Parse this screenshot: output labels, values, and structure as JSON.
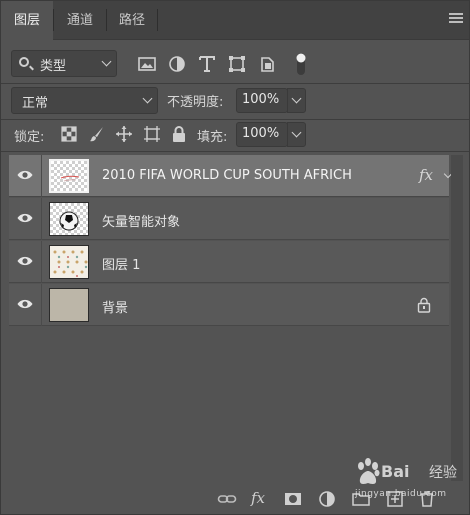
{
  "tabs": [
    {
      "label": "图层",
      "active": true
    },
    {
      "label": "通道",
      "active": false
    },
    {
      "label": "路径",
      "active": false
    }
  ],
  "filter": {
    "kind_label": "类型",
    "icons": [
      "image-filter-icon",
      "adjustment-filter-icon",
      "type-filter-icon",
      "shape-filter-icon",
      "smart-object-filter-icon",
      "filter-toggle-icon"
    ]
  },
  "blend": {
    "mode": "正常",
    "opacity_label": "不透明度:",
    "opacity_value": "100%"
  },
  "lock": {
    "label": "锁定:",
    "fill_label": "填充:",
    "fill_value": "100%",
    "icons": [
      "lock-transparent-pixels-icon",
      "lock-image-pixels-icon",
      "lock-position-icon",
      "lock-artboard-icon",
      "lock-all-icon"
    ]
  },
  "layers": [
    {
      "name": "2010  FIFA WORLD CUP SOUTH AFRICH",
      "selected": true,
      "has_fx": true,
      "fx_label": "fx",
      "thumb": "text",
      "locked": false
    },
    {
      "name": "矢量智能对象",
      "selected": false,
      "has_fx": false,
      "thumb": "ball",
      "locked": false
    },
    {
      "name": "图层 1",
      "selected": false,
      "has_fx": false,
      "thumb": "pattern",
      "locked": false
    },
    {
      "name": "背景",
      "selected": false,
      "has_fx": false,
      "thumb": "solid",
      "locked": true
    }
  ],
  "footer": {
    "icons": [
      "link-layers-icon",
      "add-layer-style-icon",
      "add-mask-icon",
      "new-adjustment-layer-icon",
      "new-group-icon",
      "new-layer-icon",
      "delete-layer-icon"
    ],
    "fx_label": "fx"
  },
  "watermark": {
    "brand": "Bai",
    "cn": "经验",
    "sub": "jingyan.baidu.com"
  },
  "colors": {
    "panel_bg": "#535353",
    "selected_layer": "#747474",
    "background_thumb": "#bcb6a8"
  }
}
